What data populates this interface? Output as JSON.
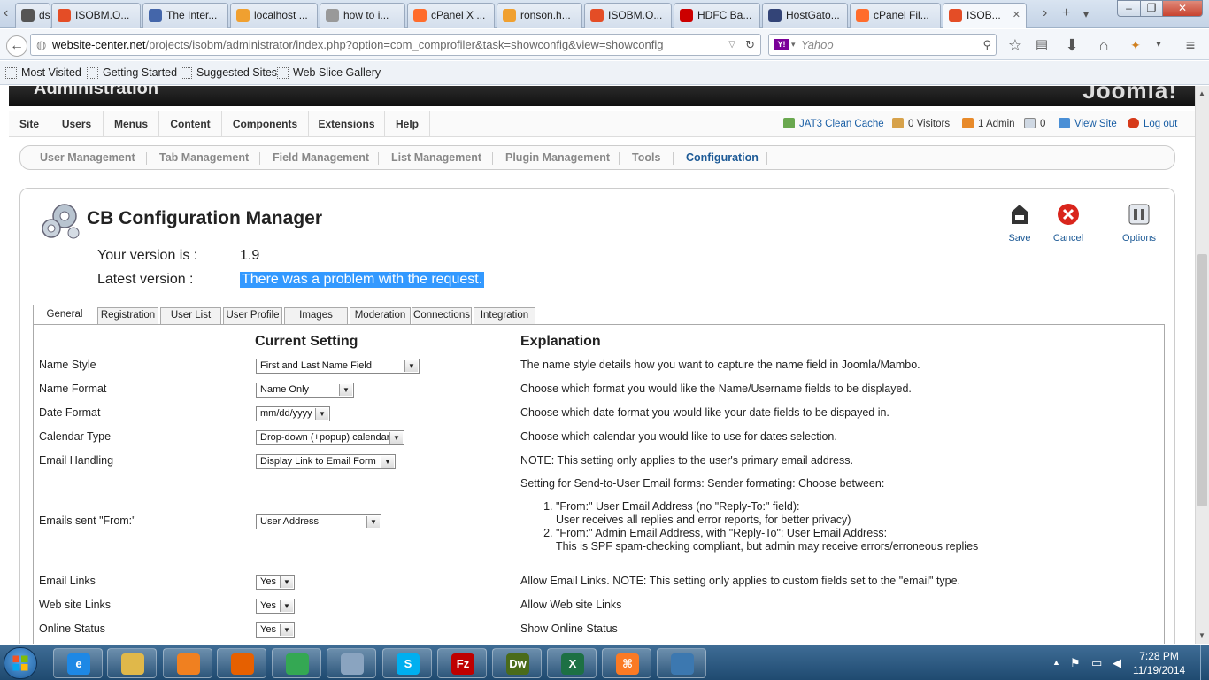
{
  "browser": {
    "tabs": [
      {
        "label": "ds ...",
        "icon": "page-icon",
        "color": "#555555"
      },
      {
        "label": "ISOBM.O...",
        "icon": "joomla-icon",
        "color": "#e44d26"
      },
      {
        "label": "The Inter...",
        "icon": "archive-icon",
        "color": "#4466aa"
      },
      {
        "label": "localhost ...",
        "icon": "phpmyadmin-icon",
        "color": "#f0a030"
      },
      {
        "label": "how to i...",
        "icon": "document-icon",
        "color": "#999999"
      },
      {
        "label": "cPanel X ...",
        "icon": "cpanel-icon",
        "color": "#ff6c2c"
      },
      {
        "label": "ronson.h...",
        "icon": "phpmyadmin-icon",
        "color": "#f0a030"
      },
      {
        "label": "ISOBM.O...",
        "icon": "joomla-icon",
        "color": "#e44d26"
      },
      {
        "label": "HDFC Ba...",
        "icon": "hdfc-icon",
        "color": "#cc0000"
      },
      {
        "label": "HostGato...",
        "icon": "hostgator-icon",
        "color": "#334477"
      },
      {
        "label": "cPanel Fil...",
        "icon": "cpanel-icon",
        "color": "#ff6c2c"
      },
      {
        "label": "ISOB...",
        "icon": "joomla-icon",
        "color": "#e44d26"
      }
    ],
    "url_domain": "website-center.net",
    "url_path": "/projects/isobm/administrator/index.php?option=com_comprofiler&task=showconfig&view=showconfig",
    "search_engine": "Yahoo",
    "bookmarks": [
      "Most Visited",
      "Getting Started",
      "Suggested Sites",
      "Web Slice Gallery"
    ]
  },
  "admin": {
    "title": "Administration",
    "logo_text": "Joomla!",
    "menu": [
      "Site",
      "Users",
      "Menus",
      "Content",
      "Components",
      "Extensions",
      "Help"
    ],
    "status": {
      "cache": "JAT3 Clean Cache",
      "visitors": "0 Visitors",
      "admins": "1 Admin",
      "messages": "0",
      "view_site": "View Site",
      "logout": "Log out"
    },
    "submenu": [
      "User Management",
      "Tab Management",
      "Field Management",
      "List Management",
      "Plugin Management",
      "Tools",
      "Configuration"
    ],
    "active_submenu": "Configuration"
  },
  "page": {
    "title": "CB Configuration Manager",
    "toolbar": {
      "save": "Save",
      "cancel": "Cancel",
      "options": "Options"
    },
    "version_label": "Your version is :",
    "version_value": "1.9",
    "latest_label": "Latest version :",
    "latest_value": "There was a problem with the request.",
    "tabs": [
      "General",
      "Registration",
      "User List",
      "User Profile",
      "Images",
      "Moderation",
      "Connections",
      "Integration"
    ],
    "active_tab": "General",
    "col_setting": "Current Setting",
    "col_explanation": "Explanation",
    "settings": [
      {
        "label": "Name Style",
        "value": "First and Last Name Field",
        "explanation": "The name style details how you want to capture the name field in Joomla/Mambo."
      },
      {
        "label": "Name Format",
        "value": "Name Only",
        "explanation": "Choose which format you would like the Name/Username fields to be displayed."
      },
      {
        "label": "Date Format",
        "value": "mm/dd/yyyy",
        "explanation": "Choose which date format you would like your date fields to be dispayed in."
      },
      {
        "label": "Calendar Type",
        "value": "Drop-down (+popup) calendar",
        "explanation": "Choose which calendar you would like to use for dates selection."
      },
      {
        "label": "Email Handling",
        "value": "Display Link to Email Form",
        "explanation": "NOTE: This setting only applies to the user's primary email address."
      },
      {
        "label": "Emails sent \"From:\"",
        "value": "User Address",
        "explanation": "Setting for Send-to-User Email forms: Sender formating: Choose between:"
      },
      {
        "label": "Email Links",
        "value": "Yes",
        "explanation": "Allow Email Links. NOTE: This setting only applies to custom fields set to the \"email\" type."
      },
      {
        "label": "Web site Links",
        "value": "Yes",
        "explanation": "Allow Web site Links"
      },
      {
        "label": "Online Status",
        "value": "Yes",
        "explanation": "Show Online Status"
      }
    ],
    "from_options": [
      {
        "line1": "\"From:\" User Email Address (no \"Reply-To:\" field):",
        "line2": "User receives all replies and error reports, for better privacy)"
      },
      {
        "line1": "\"From:\" Admin Email Address, with \"Reply-To\": User Email Address:",
        "line2": "This is SPF spam-checking compliant, but admin may receive errors/erroneous replies"
      }
    ]
  },
  "taskbar": {
    "apps": [
      {
        "name": "internet-explorer-icon",
        "glyph": "e",
        "color": "#1e88e5"
      },
      {
        "name": "file-explorer-icon",
        "glyph": "",
        "color": "#e0b84a"
      },
      {
        "name": "media-player-icon",
        "glyph": "",
        "color": "#f08020"
      },
      {
        "name": "firefox-icon",
        "glyph": "",
        "color": "#e66000"
      },
      {
        "name": "chrome-icon",
        "glyph": "",
        "color": "#34a853"
      },
      {
        "name": "notepad-icon",
        "glyph": "",
        "color": "#8aa4c0"
      },
      {
        "name": "skype-icon",
        "glyph": "S",
        "color": "#00aff0"
      },
      {
        "name": "filezilla-icon",
        "glyph": "Fz",
        "color": "#bf0000"
      },
      {
        "name": "dreamweaver-icon",
        "glyph": "Dw",
        "color": "#4a6b1a"
      },
      {
        "name": "excel-icon",
        "glyph": "X",
        "color": "#1d7044"
      },
      {
        "name": "xampp-icon",
        "glyph": "⌘",
        "color": "#fb7a24"
      },
      {
        "name": "snipping-tool-icon",
        "glyph": "",
        "color": "#3c78b0"
      }
    ],
    "time": "7:28 PM",
    "date": "11/19/2014"
  }
}
